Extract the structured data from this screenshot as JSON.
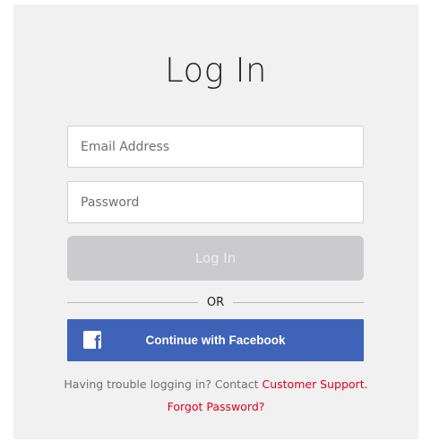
{
  "title": "Log In",
  "email": {
    "placeholder": "Email Address",
    "value": ""
  },
  "password": {
    "placeholder": "Password",
    "value": ""
  },
  "login_button": "Log In",
  "divider_text": "OR",
  "facebook": {
    "icon": "facebook-icon",
    "label": "Continue with Facebook",
    "color": "#3f63b8"
  },
  "help": {
    "prefix": "Having trouble logging in? Contact ",
    "support_link": "Customer Support",
    "suffix": ".",
    "forgot_link": "Forgot Password?",
    "link_color": "#e10019"
  }
}
